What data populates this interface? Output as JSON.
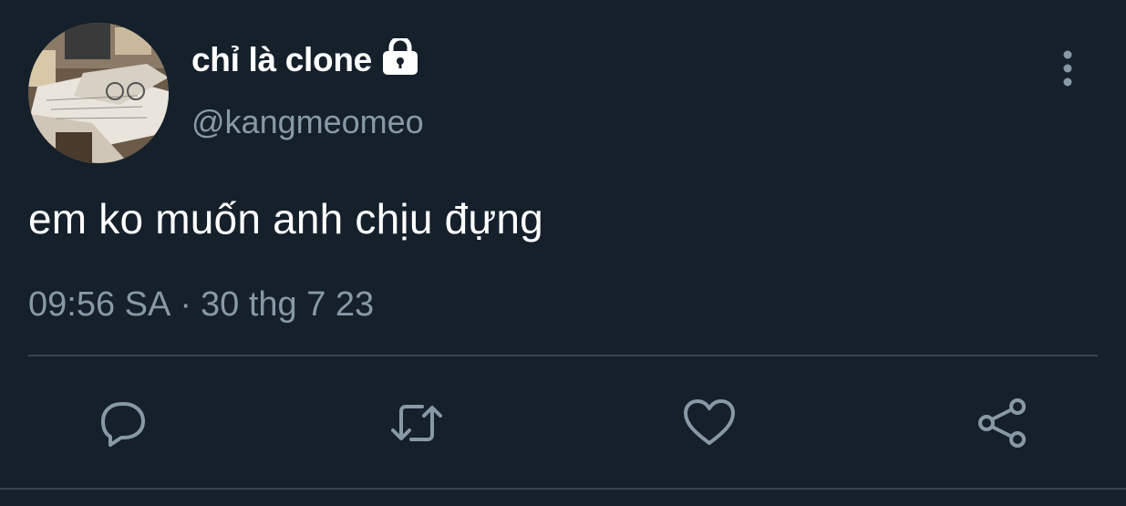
{
  "user": {
    "display_name": "chỉ là clone",
    "handle": "@kangmeomeo",
    "avatar": "avatar-photo-open-books-glasses",
    "protected_icon": "lock-icon"
  },
  "tweet": {
    "text": "em ko muốn anh chịu đựng",
    "time": "09:56 SA",
    "separator": "·",
    "date": "30 thg 7 23"
  },
  "actions": [
    {
      "name": "reply",
      "icon": "reply-icon"
    },
    {
      "name": "retweet",
      "icon": "retweet-icon"
    },
    {
      "name": "like",
      "icon": "heart-icon"
    },
    {
      "name": "share",
      "icon": "share-icon"
    }
  ],
  "colors": {
    "background": "#15202b",
    "primary_text": "#ffffff",
    "secondary_text": "#8899a6",
    "divider": "#38444d",
    "icon": "#8899a6"
  }
}
